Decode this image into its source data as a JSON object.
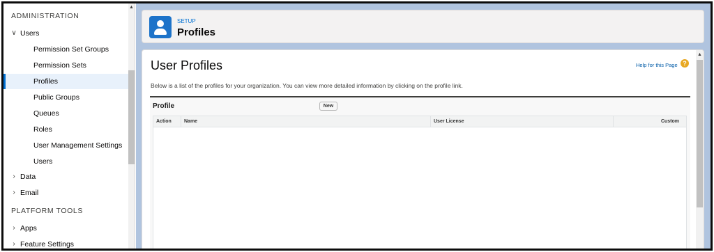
{
  "sidebar": {
    "administration_header": "ADMINISTRATION",
    "platform_tools_header": "PLATFORM TOOLS",
    "users_group": {
      "label": "Users",
      "chevron": "∨"
    },
    "user_children": [
      {
        "label": "Permission Set Groups"
      },
      {
        "label": "Permission Sets"
      },
      {
        "label": "Profiles",
        "active": true
      },
      {
        "label": "Public Groups"
      },
      {
        "label": "Queues"
      },
      {
        "label": "Roles"
      },
      {
        "label": "User Management Settings"
      },
      {
        "label": "Users"
      }
    ],
    "collapsed_groups": [
      {
        "label": "Data",
        "chevron": "›"
      },
      {
        "label": "Email",
        "chevron": "›"
      }
    ],
    "platform_groups": [
      {
        "label": "Apps",
        "chevron": "›"
      },
      {
        "label": "Feature Settings",
        "chevron": "›"
      }
    ],
    "scroll_up_glyph": "▲"
  },
  "header": {
    "eyebrow": "SETUP",
    "title": "Profiles",
    "icon": "user-icon",
    "icon_color": "#1d73c9"
  },
  "content": {
    "page_title": "User Profiles",
    "help_link": "Help for this Page",
    "help_icon_glyph": "?",
    "description": "Below is a list of the profiles for your organization. You can view more detailed information by clicking on the profile link.",
    "list": {
      "title": "Profile",
      "new_button": "New",
      "columns": [
        "Action",
        "Name",
        "User License",
        "Custom"
      ]
    },
    "scroll_up_glyph": "▲"
  },
  "colors": {
    "accent": "#0070d2",
    "background": "#b0c4df",
    "help_icon": "#e8a822"
  }
}
